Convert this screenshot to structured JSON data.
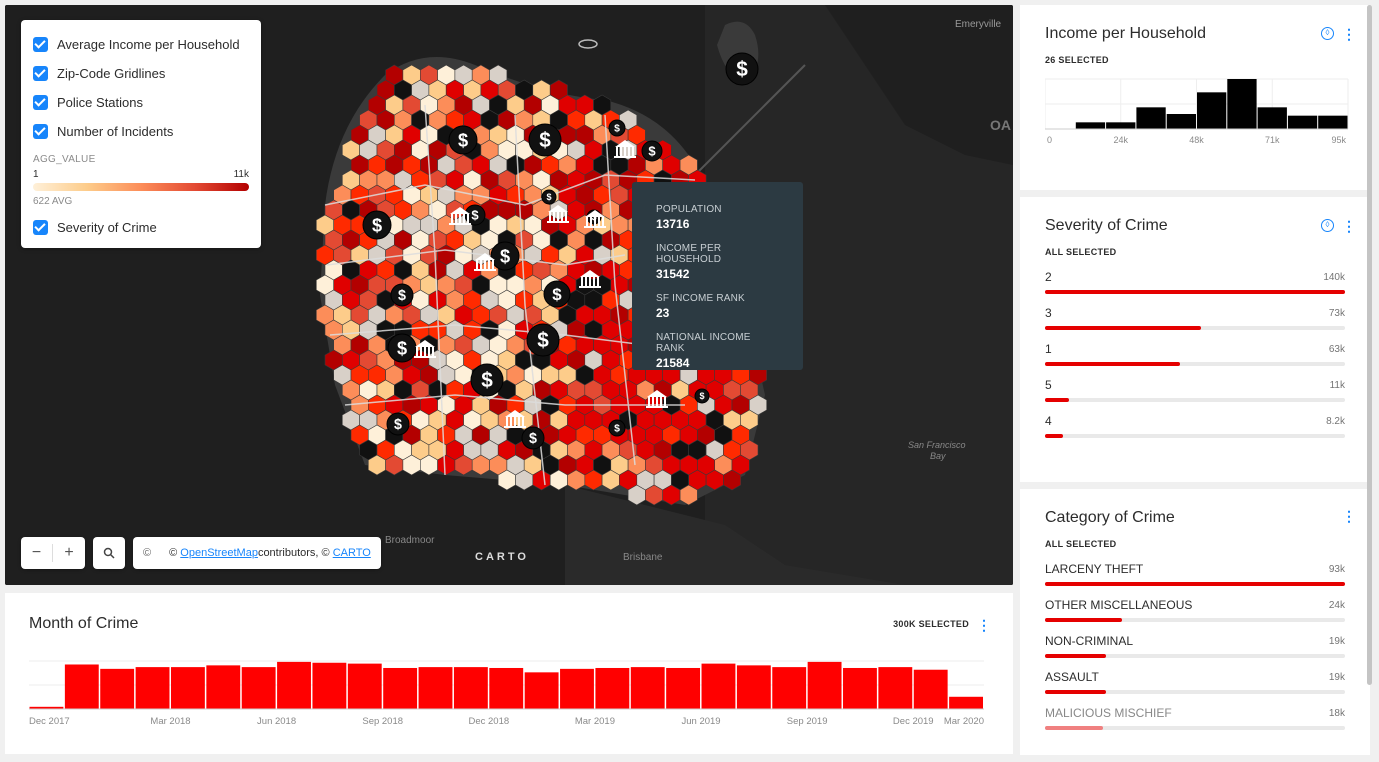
{
  "map": {
    "layers": [
      {
        "label": "Average Income per Household",
        "checked": true
      },
      {
        "label": "Zip-Code Gridlines",
        "checked": true
      },
      {
        "label": "Police Stations",
        "checked": true
      },
      {
        "label": "Number of Incidents",
        "checked": true
      },
      {
        "label": "Severity of Crime",
        "checked": true
      }
    ],
    "legend": {
      "title": "AGG_VALUE",
      "min": "1",
      "max": "11k",
      "avg": "622 AVG"
    },
    "colors": {
      "ramp": [
        "#fef0d9",
        "#fdcc8a",
        "#fc8d59",
        "#e34a33",
        "#b30000"
      ],
      "accent": "#1785fb",
      "bar": "#ff0000"
    },
    "zoom_out": "−",
    "zoom_in": "+",
    "search_icon": "search-icon",
    "attribution": {
      "copyright": "©",
      "prefix": "©",
      "osm": "OpenStreetMap",
      "mid": " contributors, ©",
      "carto": "CARTO"
    },
    "logo": "CARTO",
    "places": {
      "emeryville": "Emeryville",
      "oakland": "OA",
      "broadmoor": "Broadmoor",
      "brisbane": "Brisbane",
      "bay": "San Francisco",
      "bay2": "Bay"
    },
    "tooltip": [
      {
        "label": "POPULATION",
        "value": "13716"
      },
      {
        "label": "INCOME PER HOUSEHOLD",
        "value": "31542"
      },
      {
        "label": "SF INCOME RANK",
        "value": "23"
      },
      {
        "label": "NATIONAL INCOME RANK",
        "value": "21584"
      }
    ]
  },
  "income_widget": {
    "title": "Income per Household",
    "subtitle": "26 SELECTED"
  },
  "severity_widget": {
    "title": "Severity of Crime",
    "subtitle": "ALL SELECTED"
  },
  "category_widget": {
    "title": "Category of Crime",
    "subtitle": "ALL SELECTED"
  },
  "month_widget": {
    "title": "Month of Crime",
    "subtitle": "300K SELECTED"
  },
  "chart_data": [
    {
      "type": "bar",
      "title": "Income per Household",
      "x_ticks": [
        "0",
        "24k",
        "48k",
        "71k",
        "95k"
      ],
      "values": [
        0,
        4,
        4,
        13,
        9,
        22,
        30,
        13,
        8,
        8
      ],
      "ylim": [
        0,
        30
      ]
    },
    {
      "type": "bar",
      "title": "Severity of Crime",
      "categories": [
        "2",
        "3",
        "1",
        "5",
        "4"
      ],
      "value_labels": [
        "140k",
        "73k",
        "63k",
        "11k",
        "8.2k"
      ],
      "values": [
        140000,
        73000,
        63000,
        11000,
        8200
      ]
    },
    {
      "type": "bar",
      "title": "Category of Crime",
      "categories": [
        "LARCENY THEFT",
        "OTHER MISCELLANEOUS",
        "NON-CRIMINAL",
        "ASSAULT",
        "MALICIOUS MISCHIEF"
      ],
      "value_labels": [
        "93k",
        "24k",
        "19k",
        "19k",
        "18k"
      ],
      "values": [
        93000,
        24000,
        19000,
        19000,
        18000
      ]
    },
    {
      "type": "bar",
      "title": "Month of Crime",
      "x_ticks": [
        "Dec 2017",
        "Mar 2018",
        "Jun 2018",
        "Sep 2018",
        "Dec 2018",
        "Mar 2019",
        "Jun 2019",
        "Sep 2019",
        "Dec 2019",
        "Mar 2020"
      ],
      "values": [
        0.5,
        10.2,
        9.2,
        9.6,
        9.6,
        10,
        9.6,
        10.8,
        10.6,
        10.4,
        9.4,
        9.6,
        9.6,
        9.4,
        8.4,
        9.2,
        9.4,
        9.6,
        9.4,
        10.4,
        10,
        9.6,
        10.8,
        9.4,
        9.6,
        9,
        2.8
      ],
      "ylim": [
        0,
        11
      ]
    }
  ]
}
